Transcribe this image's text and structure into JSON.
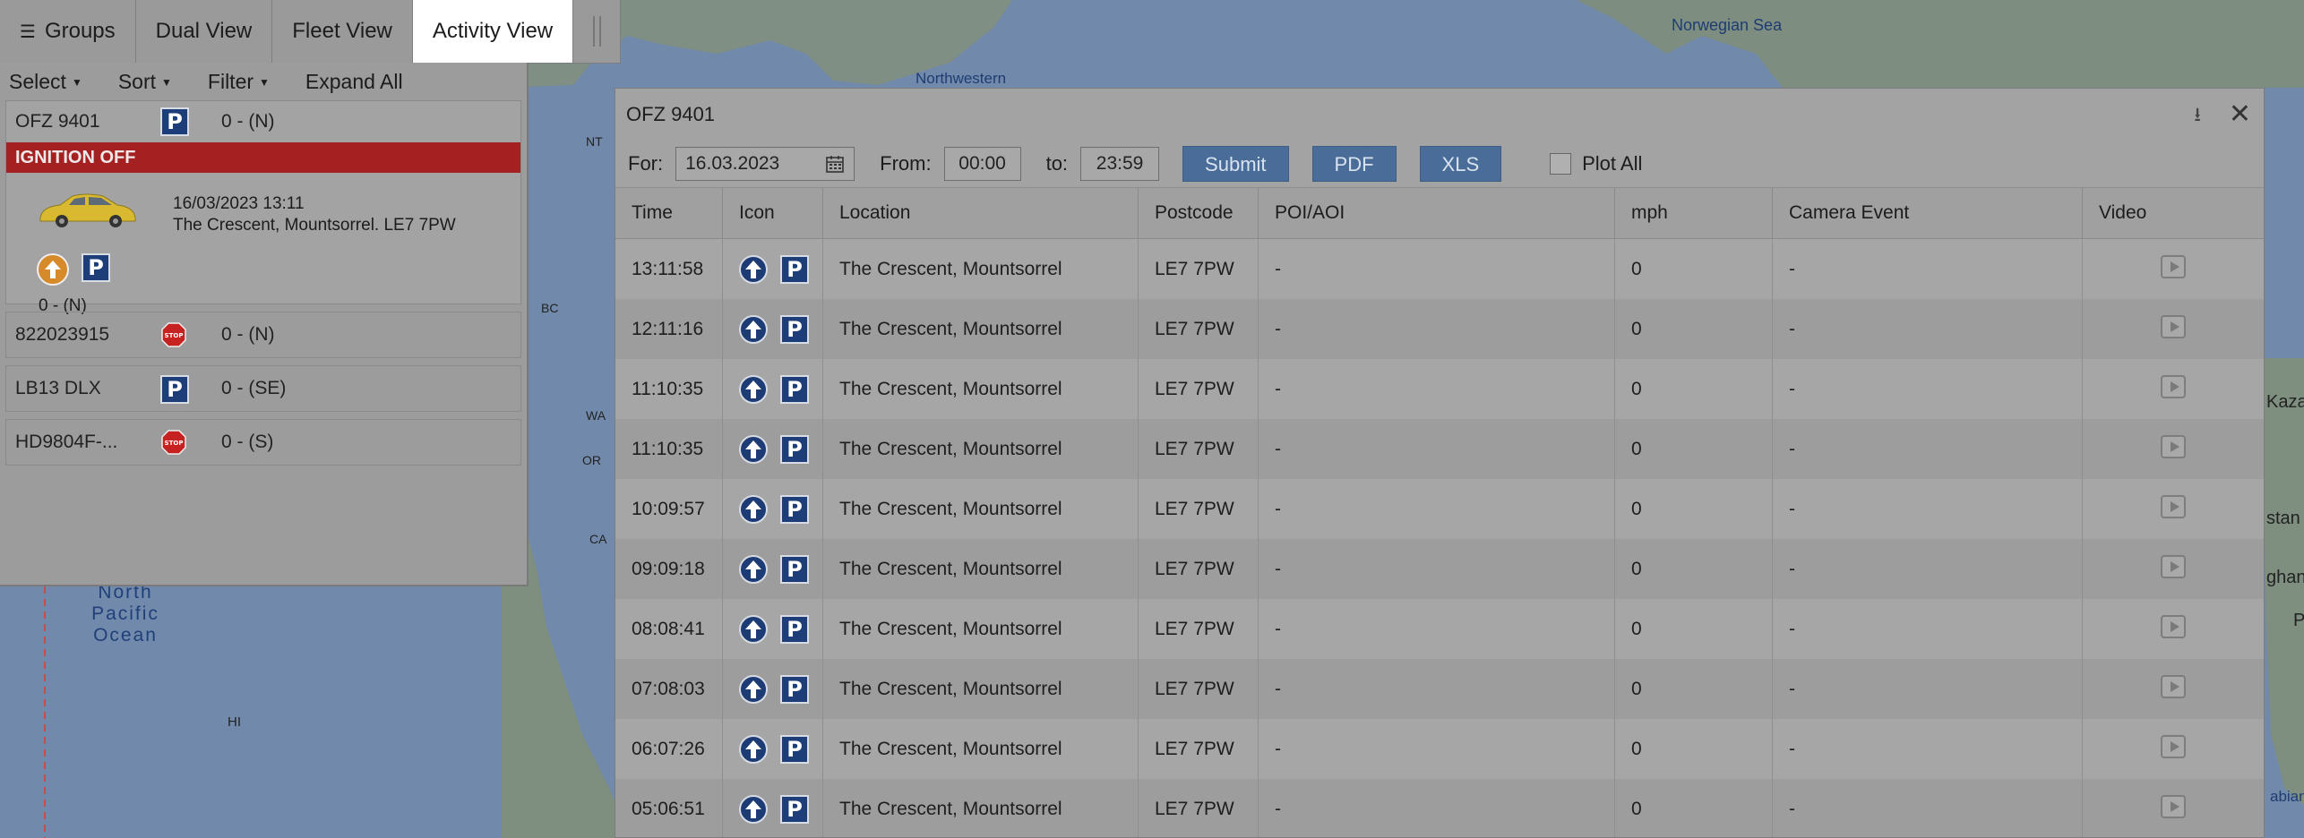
{
  "tabs": [
    {
      "label": "Groups",
      "active": false
    },
    {
      "label": "Dual View",
      "active": false
    },
    {
      "label": "Fleet View",
      "active": false
    },
    {
      "label": "Activity View",
      "active": true
    }
  ],
  "map": {
    "labels": {
      "norwegian_sea": "Norwegian Sea",
      "northwestern": "Northwestern",
      "nt": "NT",
      "bc": "BC",
      "wa": "WA",
      "or": "OR",
      "ca": "CA",
      "north_pacific_ocean": "North\nPacific\nOcean",
      "hi": "HI",
      "kaza": "Kaza",
      "stan": "stan",
      "ghan": "ghan",
      "p": "P",
      "abian": "abian"
    }
  },
  "left_panel": {
    "toolbar": {
      "select": "Select",
      "sort": "Sort",
      "filter": "Filter",
      "expand_all": "Expand All"
    },
    "selected_vehicle": {
      "name": "OFZ 9401",
      "direction": "0 - (N)",
      "status": "IGNITION OFF",
      "timestamp": "16/03/2023 13:11",
      "address": "The Crescent, Mountsorrel. LE7 7PW",
      "speed": "0 - (N)"
    },
    "vehicles": [
      {
        "name": "822023915",
        "icon": "stop-icon",
        "direction": "0 - (N)"
      },
      {
        "name": "LB13 DLX",
        "icon": "parking-icon",
        "direction": "0 - (SE)"
      },
      {
        "name": "HD9804F-...",
        "icon": "stop-icon",
        "direction": "0 - (S)"
      }
    ]
  },
  "dialog": {
    "title": "OFZ 9401",
    "filter": {
      "for_label": "For:",
      "date": "16.03.2023",
      "from_label": "From:",
      "from_time": "00:00",
      "to_label": "to:",
      "to_time": "23:59",
      "submit": "Submit",
      "pdf": "PDF",
      "xls": "XLS",
      "plot_all": "Plot All"
    },
    "columns": [
      "Time",
      "Icon",
      "Location",
      "Postcode",
      "POI/AOI",
      "mph",
      "Camera Event",
      "Video"
    ],
    "rows": [
      {
        "time": "13:11:58",
        "location": "The Crescent, Mountsorrel",
        "postcode": "LE7 7PW",
        "poi": "-",
        "mph": "0",
        "camera": "-"
      },
      {
        "time": "12:11:16",
        "location": "The Crescent, Mountsorrel",
        "postcode": "LE7 7PW",
        "poi": "-",
        "mph": "0",
        "camera": "-"
      },
      {
        "time": "11:10:35",
        "location": "The Crescent, Mountsorrel",
        "postcode": "LE7 7PW",
        "poi": "-",
        "mph": "0",
        "camera": "-"
      },
      {
        "time": "11:10:35",
        "location": "The Crescent, Mountsorrel",
        "postcode": "LE7 7PW",
        "poi": "-",
        "mph": "0",
        "camera": "-"
      },
      {
        "time": "10:09:57",
        "location": "The Crescent, Mountsorrel",
        "postcode": "LE7 7PW",
        "poi": "-",
        "mph": "0",
        "camera": "-"
      },
      {
        "time": "09:09:18",
        "location": "The Crescent, Mountsorrel",
        "postcode": "LE7 7PW",
        "poi": "-",
        "mph": "0",
        "camera": "-"
      },
      {
        "time": "08:08:41",
        "location": "The Crescent, Mountsorrel",
        "postcode": "LE7 7PW",
        "poi": "-",
        "mph": "0",
        "camera": "-"
      },
      {
        "time": "07:08:03",
        "location": "The Crescent, Mountsorrel",
        "postcode": "LE7 7PW",
        "poi": "-",
        "mph": "0",
        "camera": "-"
      },
      {
        "time": "06:07:26",
        "location": "The Crescent, Mountsorrel",
        "postcode": "LE7 7PW",
        "poi": "-",
        "mph": "0",
        "camera": "-"
      },
      {
        "time": "05:06:51",
        "location": "The Crescent, Mountsorrel",
        "postcode": "LE7 7PW",
        "poi": "-",
        "mph": "0",
        "camera": "-"
      }
    ]
  }
}
